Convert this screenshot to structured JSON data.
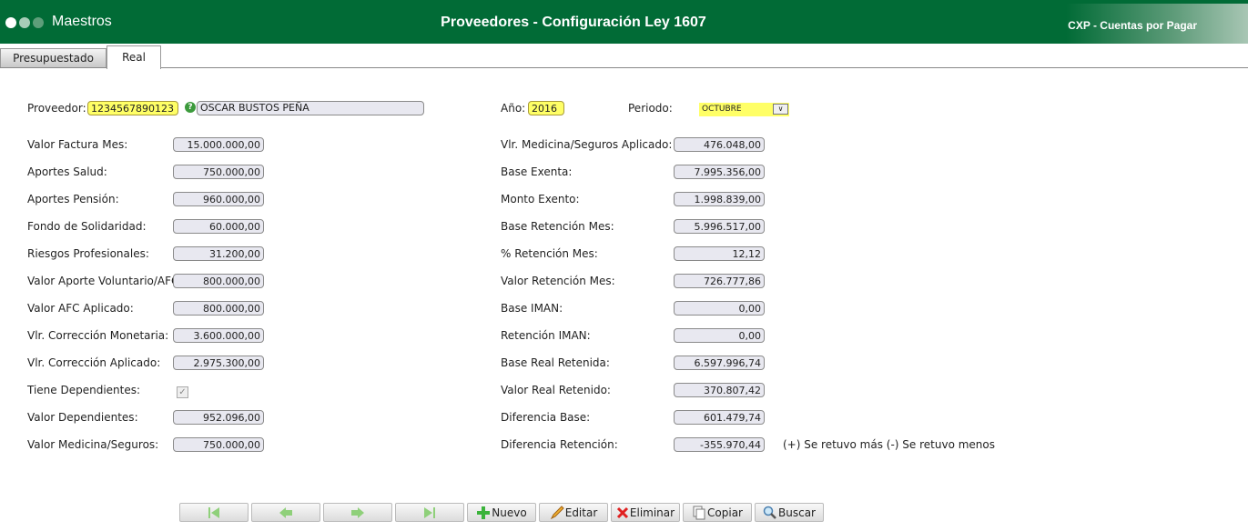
{
  "header": {
    "module": "Maestros",
    "title": "Proveedores - Configuración Ley 1607",
    "app": "CXP - Cuentas por Pagar",
    "color": "#016b36"
  },
  "tabs": [
    {
      "label": "Presupuestado",
      "active": false
    },
    {
      "label": "Real",
      "active": true
    }
  ],
  "proveedor": {
    "label": "Proveedor:",
    "code": "1234567890123",
    "name": "OSCAR BUSTOS PEÑA"
  },
  "anio": {
    "label": "Año:",
    "value": "2016"
  },
  "periodo": {
    "label": "Periodo:",
    "value": "OCTUBRE"
  },
  "left": [
    {
      "label": "Valor Factura Mes:",
      "value": "15.000.000,00"
    },
    {
      "label": "Aportes Salud:",
      "value": "750.000,00"
    },
    {
      "label": "Aportes Pensión:",
      "value": "960.000,00"
    },
    {
      "label": "Fondo de Solidaridad:",
      "value": "60.000,00"
    },
    {
      "label": "Riesgos Profesionales:",
      "value": "31.200,00"
    },
    {
      "label": "Valor Aporte Voluntario/AFC:",
      "value": "800.000,00"
    },
    {
      "label": "Valor AFC Aplicado:",
      "value": "800.000,00"
    },
    {
      "label": "Vlr. Corrección Monetaria:",
      "value": "3.600.000,00"
    },
    {
      "label": "Vlr. Corrección Aplicado:",
      "value": "2.975.300,00"
    },
    {
      "label": "Tiene Dependientes:",
      "checked": true
    },
    {
      "label": "Valor Dependientes:",
      "value": "952.096,00"
    },
    {
      "label": "Valor Medicina/Seguros:",
      "value": "750.000,00"
    }
  ],
  "right": [
    {
      "label": "Vlr. Medicina/Seguros Aplicado:",
      "value": "476.048,00"
    },
    {
      "label": "Base Exenta:",
      "value": "7.995.356,00"
    },
    {
      "label": "Monto Exento:",
      "value": "1.998.839,00"
    },
    {
      "label": "Base Retención Mes:",
      "value": "5.996.517,00"
    },
    {
      "label": "% Retención Mes:",
      "value": "12,12"
    },
    {
      "label": "Valor Retención Mes:",
      "value": "726.777,86"
    },
    {
      "label": "Base IMAN:",
      "value": "0,00"
    },
    {
      "label": "Retención IMAN:",
      "value": "0,00"
    },
    {
      "label": "Base Real Retenida:",
      "value": "6.597.996,74"
    },
    {
      "label": "Valor Real Retenido:",
      "value": "370.807,42"
    },
    {
      "label": "Diferencia Base:",
      "value": "601.479,74"
    },
    {
      "label": "Diferencia Retención:",
      "value": "-355.970,44"
    }
  ],
  "note": "(+) Se retuvo más (-) Se retuvo menos",
  "toolbar": [
    {
      "icon": "first-icon",
      "label": ""
    },
    {
      "icon": "prev-icon",
      "label": ""
    },
    {
      "icon": "next-icon",
      "label": ""
    },
    {
      "icon": "last-icon",
      "label": ""
    },
    {
      "icon": "plus-icon",
      "label": "Nuevo"
    },
    {
      "icon": "pencil-icon",
      "label": "Editar"
    },
    {
      "icon": "x-icon",
      "label": "Eliminar"
    },
    {
      "icon": "copy-icon",
      "label": "Copiar"
    },
    {
      "icon": "search-icon",
      "label": "Buscar"
    }
  ]
}
